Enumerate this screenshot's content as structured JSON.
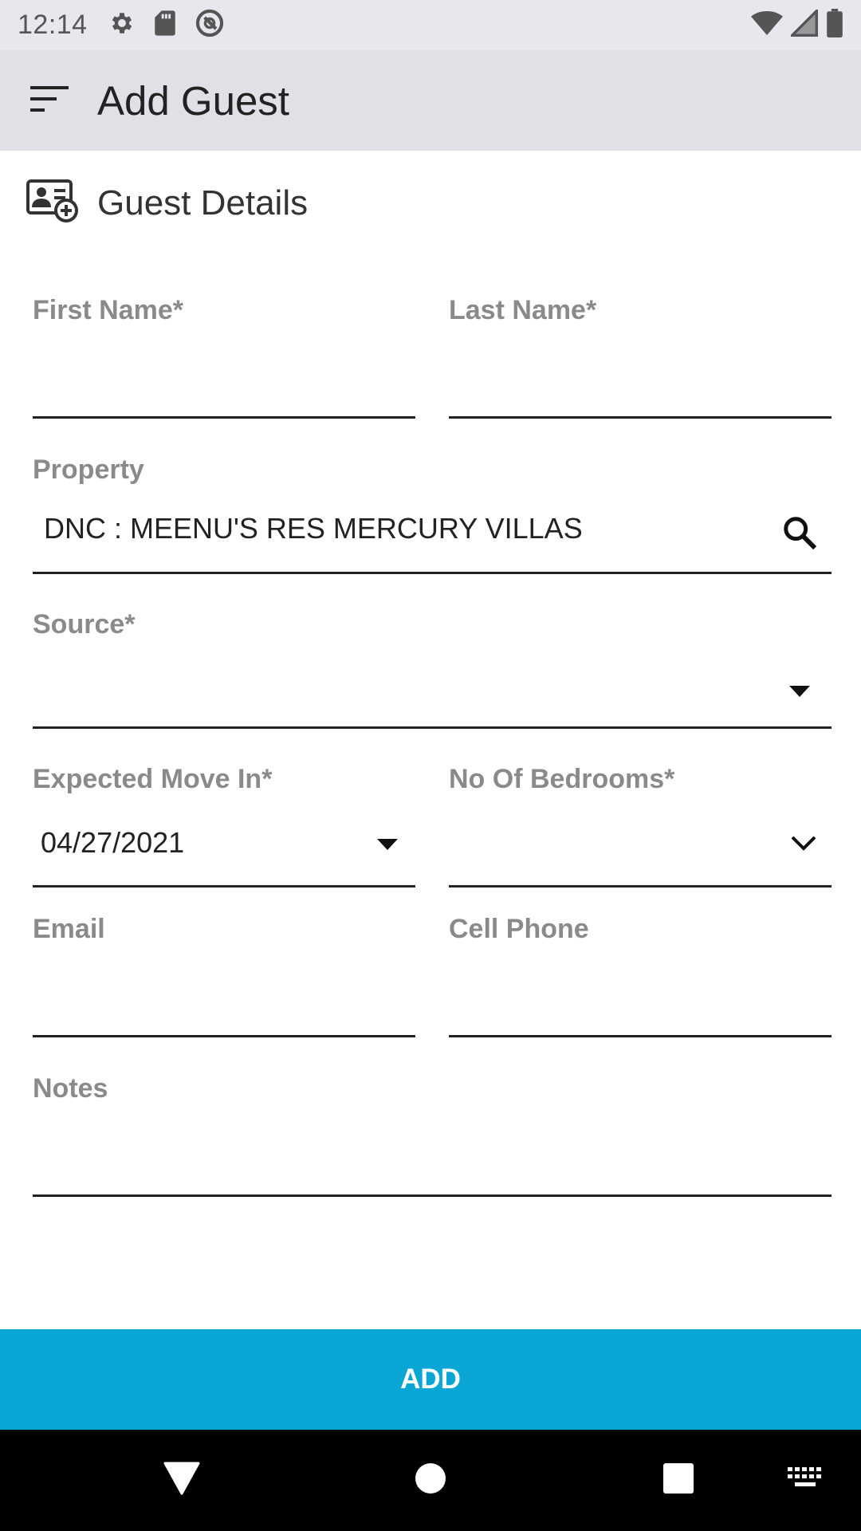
{
  "status_bar": {
    "time": "12:14",
    "left_icons": [
      "gear-icon",
      "sd-card-icon",
      "no-sync-icon"
    ],
    "right_icons": [
      "wifi-icon",
      "cell-signal-icon",
      "battery-icon"
    ]
  },
  "app_bar": {
    "title": "Add Guest",
    "menu_icon": "menu-sort-icon"
  },
  "section": {
    "title": "Guest Details",
    "icon": "add-contact-card-icon"
  },
  "form": {
    "first_name": {
      "label": "First Name*",
      "value": ""
    },
    "last_name": {
      "label": "Last Name*",
      "value": ""
    },
    "property": {
      "label": "Property",
      "value": "DNC : MEENU'S RES MERCURY VILLAS",
      "icon": "search-icon"
    },
    "source": {
      "label": "Source*",
      "value": "",
      "icon": "dropdown-arrow-icon"
    },
    "expected_move_in": {
      "label": "Expected Move In*",
      "value": "04/27/2021",
      "icon": "dropdown-arrow-icon"
    },
    "bedrooms": {
      "label": "No Of Bedrooms*",
      "value": "",
      "icon": "chevron-down-icon"
    },
    "email": {
      "label": "Email",
      "value": ""
    },
    "cell_phone": {
      "label": "Cell Phone",
      "value": ""
    },
    "notes": {
      "label": "Notes",
      "value": ""
    }
  },
  "add_button": {
    "label": "ADD"
  },
  "colors": {
    "accent": "#0aa7d6",
    "app_bar": "#e1e0e6",
    "status_bar": "#e8e7ee",
    "label": "#8a8a8a"
  },
  "nav_bar": {
    "buttons": [
      "back-icon",
      "home-icon",
      "recents-icon",
      "keyboard-icon"
    ]
  }
}
